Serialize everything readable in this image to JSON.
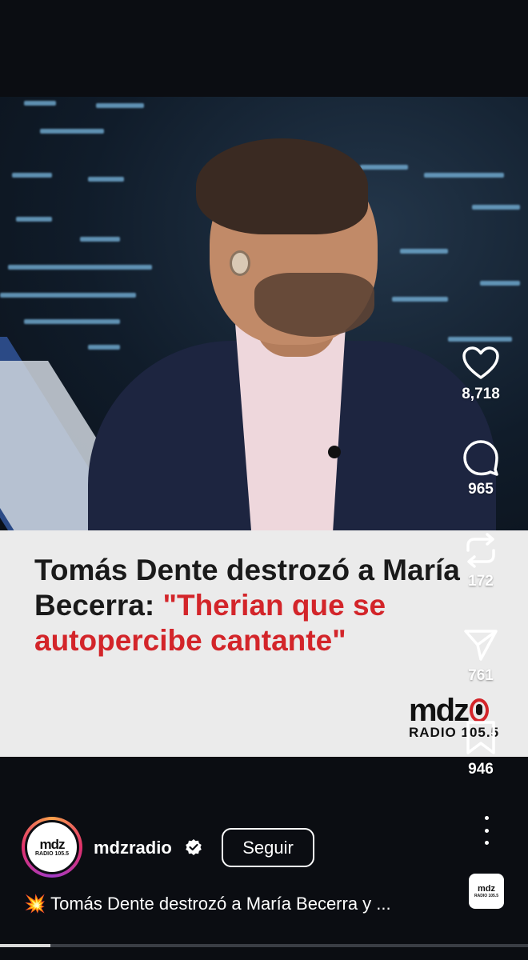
{
  "video": {
    "headline_line1": "Tomás Dente destrozó a María",
    "headline_line2_black": "Becerra: ",
    "headline_line2_red": "\"Therian que se",
    "headline_line3_red": "autopercibe cantante\"",
    "logo_text": "mdz",
    "logo_radio": "RADIO 105.5",
    "progress_fraction": 0.095
  },
  "actions": {
    "like_count": "8,718",
    "comment_count": "965",
    "repost_count": "172",
    "share_count": "761",
    "save_count": "946"
  },
  "author": {
    "avatar_text": "mdz",
    "avatar_radio": "RADIO 105.5",
    "username": "mdzradio",
    "follow_label": "Seguir"
  },
  "caption": {
    "emoji": "💥",
    "text": "Tomás Dente destrozó a María Becerra y ..."
  },
  "audio": {
    "thumb_text": "mdz",
    "thumb_radio": "RADIO 105.5"
  },
  "colors": {
    "accent_red": "#d3252a",
    "background": "#0b0d12",
    "caption_card": "#ebebeb"
  },
  "icons": [
    "heart-icon",
    "comment-icon",
    "repost-icon",
    "share-icon",
    "bookmark-icon",
    "more-icon",
    "verified-badge-icon"
  ]
}
